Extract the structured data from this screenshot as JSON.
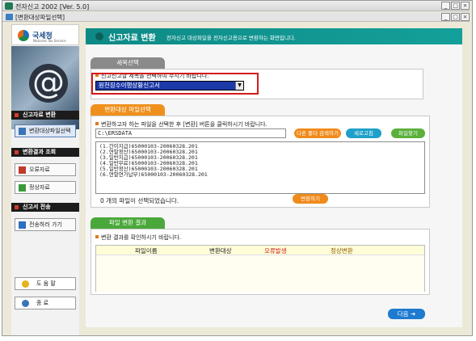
{
  "window": {
    "title": "전자신고 2002 [Ver. 5.0]",
    "subtitle": "[변환대상파일선택]",
    "controls": [
      "_",
      "□",
      "×"
    ]
  },
  "brand": {
    "name": "국세청",
    "tagline": "National Tax Service",
    "hero_symbol": "@"
  },
  "sidebar": {
    "section_convert": "신고자료 변환",
    "convert_button": "변환대상파일선택",
    "section_results": "변환결과 조회",
    "error_button": "오류자료",
    "normal_button": "정상자료",
    "section_send": "신고서 전송",
    "send_button": "전송하러 가기",
    "help_button": "도 움 말",
    "exit_button": "종   료"
  },
  "header": {
    "title": "신고자료 변환",
    "description": "전자신고 대상파일을 전자신고용으로 변환하는 화면입니다."
  },
  "form_select": {
    "tab": "세목선택",
    "hint": "신고신고할 세목을 선택하여 주시기 바랍니다.",
    "selected": "원천징수이행상황신고서"
  },
  "file_select": {
    "tab": "변환대상 파일선택",
    "hint": "변환하고자 하는 파일을 선택한 후 [변환] 버튼을 클릭하시기 바랍니다.",
    "path": "C:\\ERSDATA",
    "btn_all": "다른 폴더 검색하기",
    "btn_refresh": "새로고침",
    "btn_find": "파일찾기",
    "files": [
      "(1.간이지급)65000103-20060328.201",
      "(2.연말정산)65000103-20060328.201",
      "(3.일반지급)65000103-20060328.201",
      "(4.일반무료)65000103-20060328.201",
      "(5.일반정산)65000103-20060328.201",
      "(6.연말연가납부)65000103-20060328.201"
    ],
    "status": "0 개의 파일이 선택되었습니다.",
    "convert_button": "변환하기"
  },
  "result": {
    "tab": "파일 변환 결과",
    "hint": "변환 결과를 확인하시기 바랍니다.",
    "columns": [
      "파일이름",
      "변환대상",
      "오류발생",
      "정상변환"
    ]
  },
  "next_button": "다음",
  "colors": {
    "teal": "#129590",
    "orange": "#f0901c",
    "green": "#4aa83a",
    "blue": "#1c3aa8",
    "red_box": "#d41a1a",
    "error_text": "#d41a1a"
  }
}
